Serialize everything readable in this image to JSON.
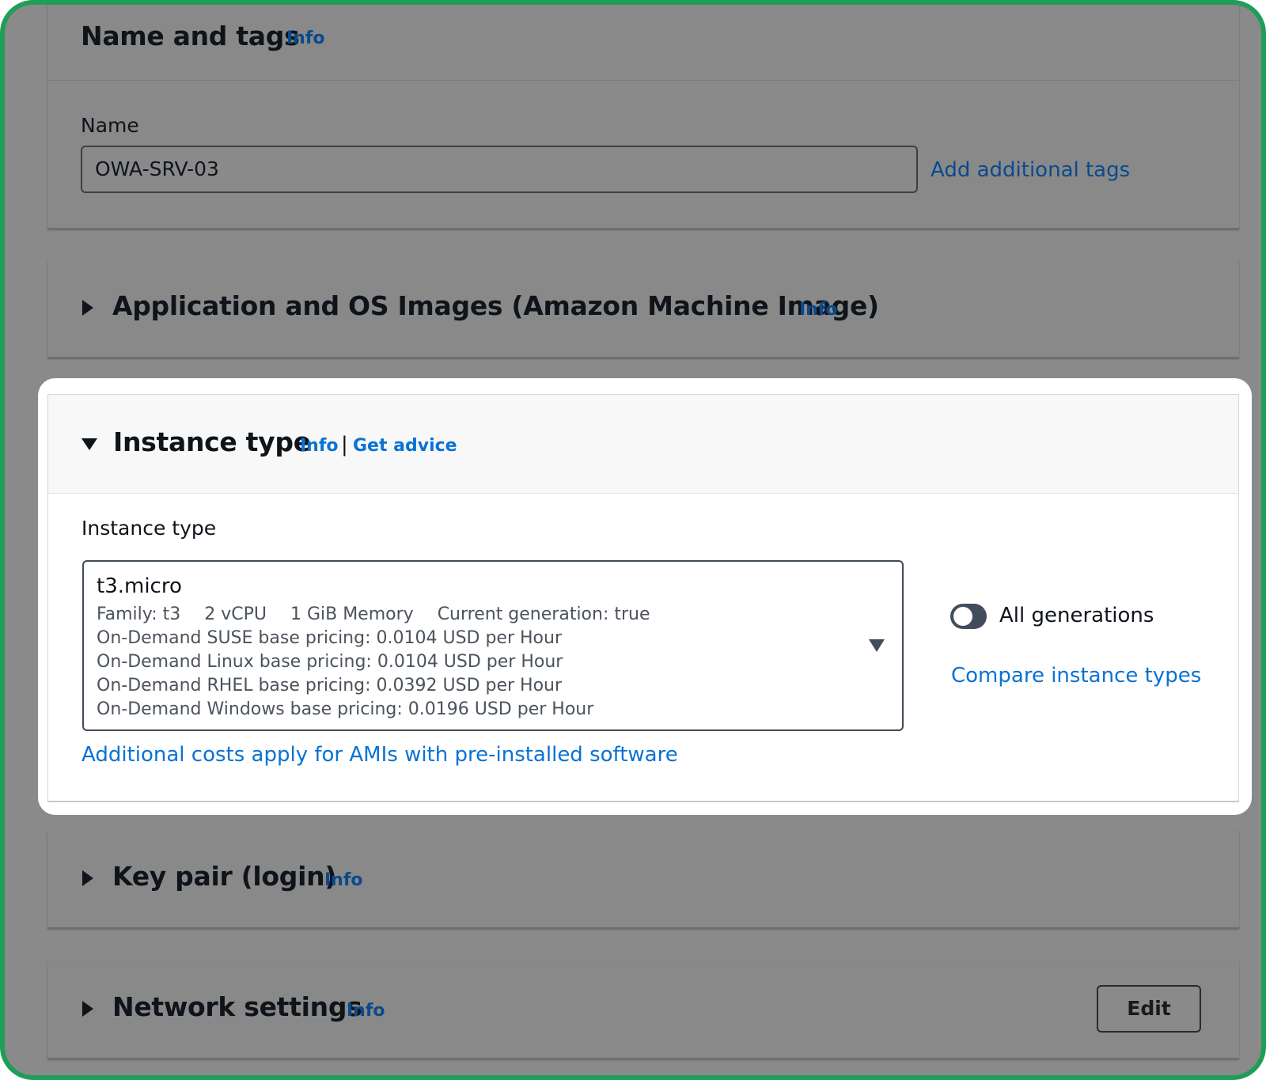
{
  "name_tags": {
    "title": "Name and tags",
    "info": "Info",
    "name_label": "Name",
    "name_value": "OWA-SRV-03",
    "add_tags_link": "Add additional tags"
  },
  "ami": {
    "title": "Application and OS Images (Amazon Machine Image)",
    "info": "Info"
  },
  "instance_type": {
    "title": "Instance type",
    "info": "Info",
    "separator": "|",
    "get_advice": "Get advice",
    "field_label": "Instance type",
    "selected": {
      "name": "t3.micro",
      "family": "Family: t3",
      "vcpu": "2 vCPU",
      "memory": "1 GiB Memory",
      "generation": "Current generation: true",
      "pricing": [
        "On-Demand SUSE base pricing: 0.0104 USD per Hour",
        "On-Demand Linux base pricing: 0.0104 USD per Hour",
        "On-Demand RHEL base pricing: 0.0392 USD per Hour",
        "On-Demand Windows base pricing: 0.0196 USD per Hour"
      ]
    },
    "additional_costs_link": "Additional costs apply for AMIs with pre-installed software",
    "all_generations_label": "All generations",
    "all_generations_on": false,
    "compare_link": "Compare instance types"
  },
  "key_pair": {
    "title": "Key pair (login)",
    "info": "Info"
  },
  "network": {
    "title": "Network settings",
    "info": "Info",
    "edit_button": "Edit"
  },
  "colors": {
    "frame_border": "#1e9e57",
    "link_blue": "#0972d3",
    "overlay_gray": "#8a8a8a"
  }
}
